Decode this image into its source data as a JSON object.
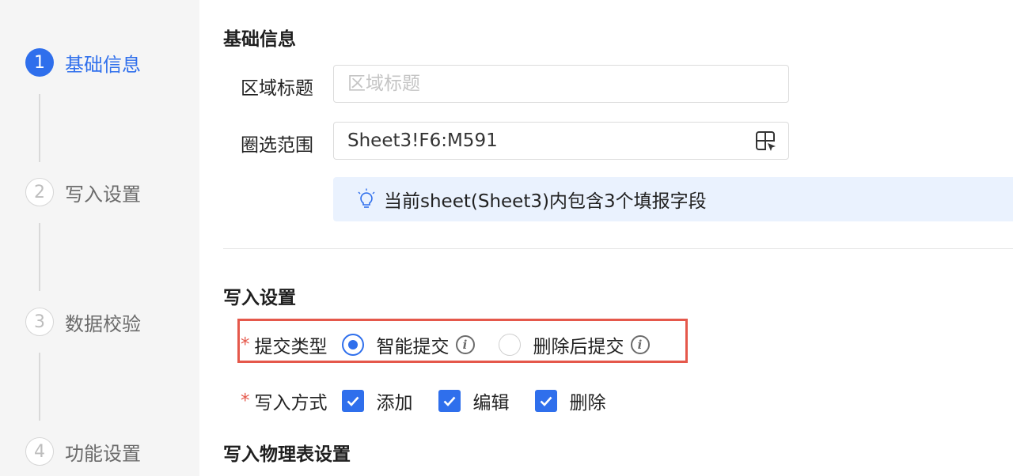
{
  "steps": [
    {
      "num": "1",
      "label": "基础信息",
      "active": true
    },
    {
      "num": "2",
      "label": "写入设置",
      "active": false
    },
    {
      "num": "3",
      "label": "数据校验",
      "active": false
    },
    {
      "num": "4",
      "label": "功能设置",
      "active": false
    }
  ],
  "basic": {
    "title": "基础信息",
    "area_title_label": "区域标题",
    "area_title_placeholder": "区域标题",
    "area_title_value": "",
    "range_label": "圈选范围",
    "range_value": "Sheet3!F6:M591",
    "tip_text": "当前sheet(Sheet3)内包含3个填报字段"
  },
  "write": {
    "title": "写入设置",
    "required_mark": "*",
    "submit_type_label": "提交类型",
    "submit_options": [
      {
        "label": "智能提交",
        "checked": true
      },
      {
        "label": "删除后提交",
        "checked": false
      }
    ],
    "write_mode_label": "写入方式",
    "write_modes": [
      {
        "label": "添加",
        "checked": true
      },
      {
        "label": "编辑",
        "checked": true
      },
      {
        "label": "删除",
        "checked": true
      }
    ]
  },
  "physical": {
    "title": "写入物理表设置"
  },
  "icons": {
    "range_picker": "select-range-icon",
    "tip": "lightbulb-icon",
    "info": "info-icon",
    "check": "checkmark-icon"
  },
  "colors": {
    "accent": "#2f6fec",
    "required": "#e5584b",
    "tip_bg": "#eaf2fe",
    "highlight_border": "#e5584b"
  }
}
